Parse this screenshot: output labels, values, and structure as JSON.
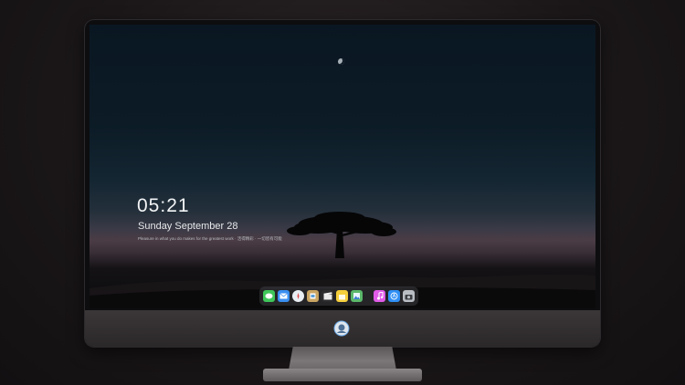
{
  "lockscreen": {
    "time": "05:21",
    "date": "Sunday September  28",
    "quote": "Pleasure in what you do makes for the greatest work · 活得精彩 · 一切皆有可能"
  },
  "dock": {
    "items": [
      {
        "name": "messages",
        "icon": "messages-icon",
        "color": "#3fc65a"
      },
      {
        "name": "mail",
        "icon": "mail-icon",
        "color": "#3a8ff0"
      },
      {
        "name": "safari",
        "icon": "compass-icon",
        "color": "#e9eef3"
      },
      {
        "name": "preview",
        "icon": "preview-icon",
        "color": "#c9a563"
      },
      {
        "name": "clapper",
        "icon": "clapper-icon",
        "color": "#2c2c2e"
      },
      {
        "name": "notes",
        "icon": "notes-icon",
        "color": "#f5cf3c"
      },
      {
        "name": "photos",
        "icon": "photos-icon",
        "color": "#5ab86a"
      },
      {
        "name": "itunes",
        "icon": "music-icon",
        "color": "#e05ce8"
      },
      {
        "name": "app-store",
        "icon": "app-store-icon",
        "color": "#2f8ff5"
      },
      {
        "name": "camera",
        "icon": "camera-icon",
        "color": "#b9bec4"
      }
    ]
  },
  "colors": {
    "bezel": "#0d0d0f",
    "chin": "#333032",
    "sky_top": "#0a1722",
    "horizon": "#4b3c45"
  }
}
